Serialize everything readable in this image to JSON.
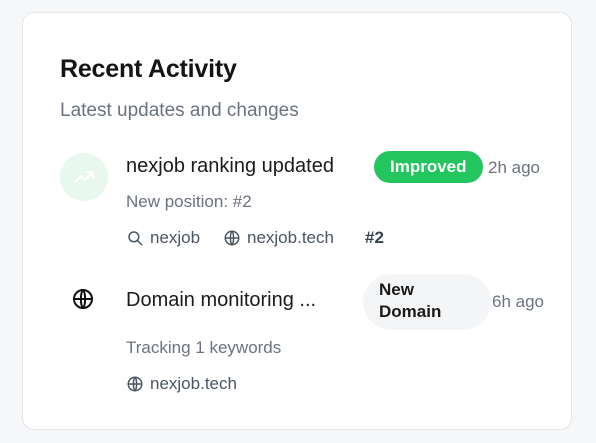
{
  "card": {
    "title": "Recent Activity",
    "subtitle": "Latest updates and changes"
  },
  "activities": [
    {
      "icon": "trending-up-icon",
      "title": "nexjob ranking updated",
      "badge": "Improved",
      "time": "2h ago",
      "detail": "New position: #2",
      "keyword": "nexjob",
      "domain": "nexjob.tech",
      "position": "#2"
    },
    {
      "icon": "globe-icon",
      "title": "Domain monitoring ...",
      "badge": "New Domain",
      "time": "6h ago",
      "detail": "Tracking 1 keywords",
      "domain": "nexjob.tech"
    }
  ],
  "colors": {
    "badge_improved_bg": "#22c55e",
    "badge_new_bg": "#f4f5f7",
    "icon_circle_bg": "#e9f8ef",
    "muted_text": "#6b7280"
  }
}
